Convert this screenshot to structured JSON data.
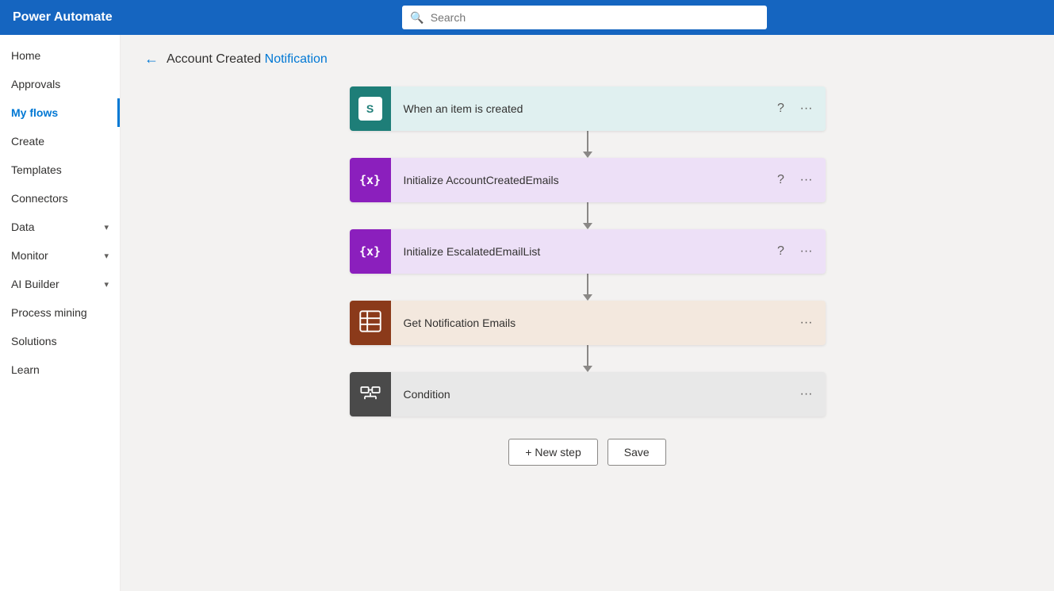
{
  "app": {
    "title": "Power Automate"
  },
  "topbar": {
    "title": "Power Automate",
    "search_placeholder": "Search"
  },
  "sidebar": {
    "items": [
      {
        "id": "home",
        "label": "Home",
        "active": false,
        "hasChevron": false
      },
      {
        "id": "approvals",
        "label": "Approvals",
        "active": false,
        "hasChevron": false
      },
      {
        "id": "my-flows",
        "label": "My flows",
        "active": true,
        "hasChevron": false
      },
      {
        "id": "create",
        "label": "Create",
        "active": false,
        "hasChevron": false
      },
      {
        "id": "templates",
        "label": "Templates",
        "active": false,
        "hasChevron": false
      },
      {
        "id": "connectors",
        "label": "Connectors",
        "active": false,
        "hasChevron": false
      },
      {
        "id": "data",
        "label": "Data",
        "active": false,
        "hasChevron": true
      },
      {
        "id": "monitor",
        "label": "Monitor",
        "active": false,
        "hasChevron": true
      },
      {
        "id": "ai-builder",
        "label": "AI Builder",
        "active": false,
        "hasChevron": true
      },
      {
        "id": "process-mining",
        "label": "Process mining",
        "active": false,
        "hasChevron": false
      },
      {
        "id": "solutions",
        "label": "Solutions",
        "active": false,
        "hasChevron": false
      },
      {
        "id": "learn",
        "label": "Learn",
        "active": false,
        "hasChevron": false
      }
    ]
  },
  "breadcrumb": {
    "back_label": "←",
    "text_plain": "Account Created",
    "text_highlight": "Notification"
  },
  "flow": {
    "steps": [
      {
        "id": "trigger",
        "label": "When an item is created",
        "bg": "teal",
        "icon_type": "sharepoint",
        "has_help": true,
        "has_more": true
      },
      {
        "id": "init1",
        "label": "Initialize AccountCreatedEmails",
        "bg": "purple",
        "icon_type": "variable",
        "has_help": true,
        "has_more": true
      },
      {
        "id": "init2",
        "label": "Initialize EscalatedEmailList",
        "bg": "purple",
        "icon_type": "variable",
        "has_help": true,
        "has_more": true
      },
      {
        "id": "get-emails",
        "label": "Get Notification Emails",
        "bg": "brown",
        "icon_type": "table",
        "has_help": false,
        "has_more": true
      },
      {
        "id": "condition",
        "label": "Condition",
        "bg": "gray",
        "icon_type": "condition",
        "has_help": false,
        "has_more": true
      }
    ]
  },
  "actions": {
    "new_step_label": "+ New step",
    "save_label": "Save"
  }
}
